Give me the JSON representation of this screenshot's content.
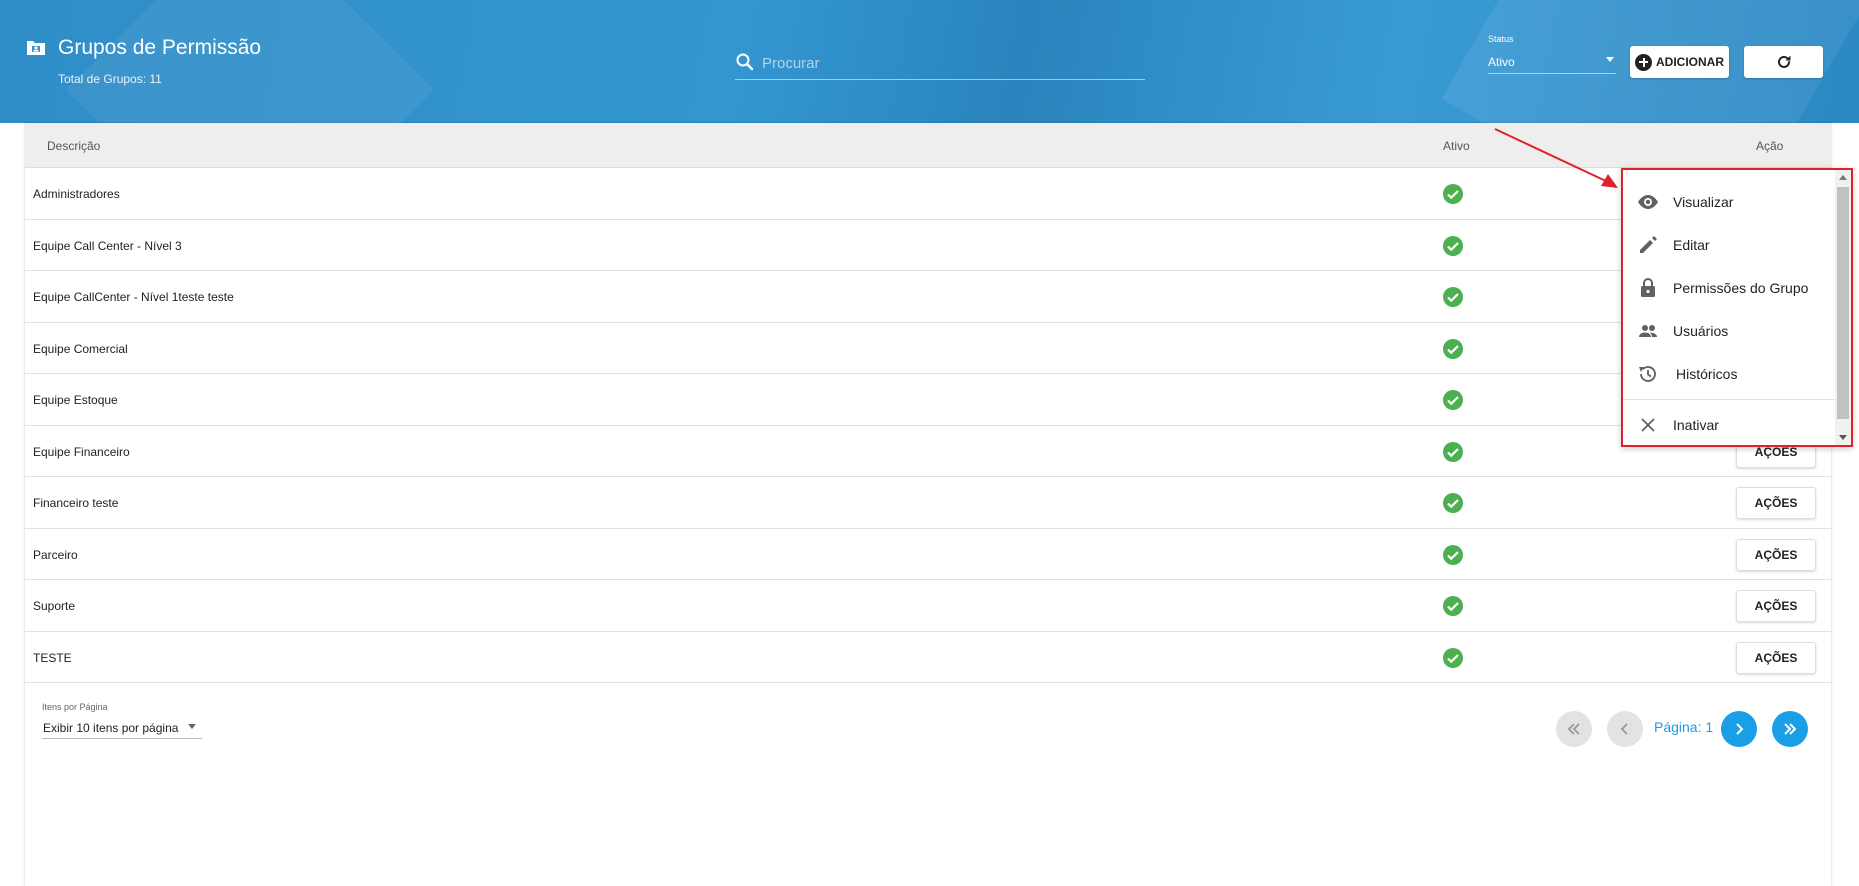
{
  "header": {
    "title": "Grupos de Permissão",
    "total_label": "Total de Grupos: 11",
    "search_placeholder": "Procurar",
    "search_value": "",
    "status_label": "Status",
    "status_value": "Ativo",
    "add_label": "ADICIONAR"
  },
  "table": {
    "columns": [
      "Descrição",
      "Ativo",
      "Ação"
    ],
    "rows": [
      {
        "desc": "Administradores",
        "active": true
      },
      {
        "desc": "Equipe Call Center - Nível 3",
        "active": true
      },
      {
        "desc": "Equipe CallCenter - Nível 1teste teste",
        "active": true
      },
      {
        "desc": "Equipe Comercial",
        "active": true
      },
      {
        "desc": "Equipe Estoque",
        "active": true
      },
      {
        "desc": "Equipe Financeiro",
        "active": true,
        "action": "AÇÕES"
      },
      {
        "desc": "Financeiro teste",
        "active": true,
        "action": "AÇÕES"
      },
      {
        "desc": "Parceiro",
        "active": true,
        "action": "AÇÕES"
      },
      {
        "desc": "Suporte",
        "active": true,
        "action": "AÇÕES"
      },
      {
        "desc": "TESTE",
        "active": true,
        "action": "AÇÕES"
      }
    ]
  },
  "footer": {
    "items_per_page_label": "Itens por Página",
    "items_per_page_value": "Exibir 10 itens por página",
    "page_label": "Página: 1"
  },
  "menu": {
    "items": [
      {
        "label": "Visualizar",
        "icon": "eye-icon"
      },
      {
        "label": "Editar",
        "icon": "pencil-icon"
      },
      {
        "label": "Permissões do Grupo",
        "icon": "lock-icon"
      },
      {
        "label": "Usuários",
        "icon": "people-icon"
      },
      {
        "label": "Históricos",
        "icon": "history-icon"
      },
      {
        "label": "Inativar",
        "icon": "close-icon"
      }
    ]
  },
  "colors": {
    "header_blue": "#3396d0",
    "check_green": "#4caf50",
    "page_blue": "#1a9ee6",
    "highlight_red": "#e0202a"
  }
}
